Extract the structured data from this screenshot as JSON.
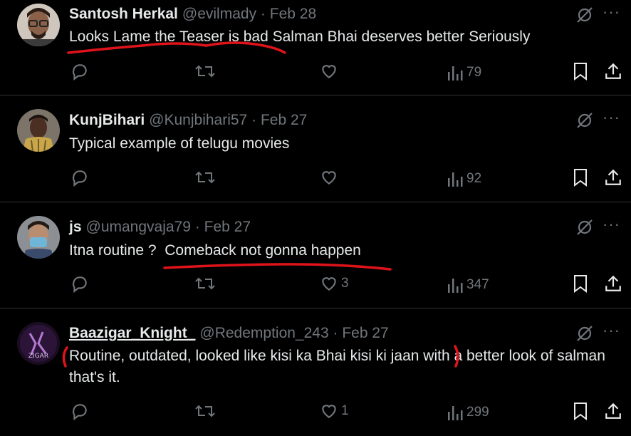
{
  "tweets": [
    {
      "name": "Santosh Herkal",
      "handle": "@evilmady",
      "separator": "·",
      "date": "Feb 28",
      "text": "Looks Lame the Teaser is bad Salman Bhai deserves better Seriously",
      "reply_count": "",
      "retweet_count": "",
      "like_count": "",
      "views": "79"
    },
    {
      "name": "KunjBihari",
      "handle": "@Kunjbihari57",
      "separator": "·",
      "date": "Feb 27",
      "text": "Typical example of telugu movies",
      "reply_count": "",
      "retweet_count": "",
      "like_count": "",
      "views": "92"
    },
    {
      "name": "js",
      "handle": "@umangvaja79",
      "separator": "·",
      "date": "Feb 27",
      "text": "Itna routine ?  Comeback not gonna happen",
      "reply_count": "",
      "retweet_count": "",
      "like_count": "3",
      "views": "347"
    },
    {
      "name": "Baazigar_Knight_",
      "handle": "@Redemption_243",
      "separator": "·",
      "date": "Feb 27",
      "text": "Routine, outdated, looked like kisi ka Bhai kisi ki jaan with a better look of salman that's it.",
      "reply_count": "",
      "retweet_count": "",
      "like_count": "1",
      "views": "299"
    }
  ],
  "more_label": "···",
  "colors": {
    "background": "#000000",
    "text": "#e7e9ea",
    "muted": "#71767b",
    "divider": "#2f3336",
    "annotation_red": "#e0131b"
  },
  "icons": [
    "grok-icon",
    "more-icon",
    "reply-icon",
    "retweet-icon",
    "like-icon",
    "views-icon",
    "bookmark-icon",
    "share-icon"
  ]
}
